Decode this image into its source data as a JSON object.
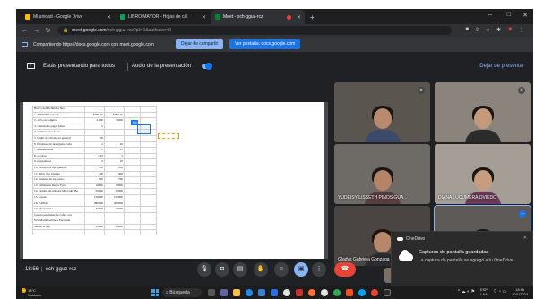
{
  "browser": {
    "tabs": [
      {
        "label": "Mi unidad - Google Drive",
        "favicon_color": "#fbbc04"
      },
      {
        "label": "LIBRO MAYOR - Hojas de cál",
        "favicon_color": "#0f9d58"
      },
      {
        "label": "Meet - och-gguz-rcz",
        "favicon_color": "#00832d"
      }
    ],
    "new_tab": "+",
    "window_controls": {
      "minimize": "–",
      "maximize": "□",
      "close": "✕"
    },
    "url_domain": "meet.google.com",
    "url_path": "/och-gguz-rcz?pli=1&authuser=0"
  },
  "share_bar": {
    "text": "Compartiendo https://docs.google.com con meet.google.com",
    "stop_label": "Dejar de compartir",
    "show_label": "Ver pestaña: docs.google.com"
  },
  "presenting": {
    "message": "Estás presentando para todos",
    "audio_label": "Audio de la presentación",
    "audio_on": true,
    "stop_label": "Dejar de presentar"
  },
  "sheet": {
    "selection_tag": "Fiil",
    "rows": [
      [
        "Banco del Pichincha Nro.",
        "",
        "",
        "",
        ""
      ],
      [
        "1. 34567390 valor S",
        "$780,25",
        "$780,25",
        "",
        ""
      ],
      [
        "2. 15% en compras",
        "5.000",
        "5000",
        "",
        ""
      ],
      [
        "3. cuentas de pagar 1mes",
        "5",
        "",
        "",
        ""
      ],
      [
        "4. archivadores de un",
        "",
        "",
        "",
        ""
      ],
      [
        "5. Útiles de oficina en general",
        "50",
        "",
        "",
        ""
      ],
      [
        "6. fundones de detergente cada",
        "2",
        "20",
        "",
        ""
      ],
      [
        "7. desinfectante",
        "2",
        "12",
        "",
        ""
      ],
      [
        "8. escobas",
        "1.25",
        "5",
        "",
        ""
      ],
      [
        "9. trapeadores",
        "2",
        "10",
        "",
        ""
      ],
      [
        "10. escritorios tipo gerente",
        "250",
        "500",
        "",
        ""
      ],
      [
        "11. sillas tipo gerente",
        "100",
        "400",
        "",
        ""
      ],
      [
        "12. estantes de tres pisos",
        "200",
        "700",
        "",
        ""
      ],
      [
        "13. camioneta marca Ford",
        "16000",
        "16000",
        "",
        ""
      ],
      [
        "14. camión de rematre Mercades Be",
        "50000",
        "50000",
        "",
        ""
      ],
      [
        "15. forraza",
        "150000",
        "150000",
        "",
        ""
      ],
      [
        "16. Edificio",
        "280000",
        "280000",
        "",
        ""
      ],
      [
        "17. Maquinaria",
        "40000",
        "40000",
        "",
        ""
      ],
      [
        "Cuenta pendiente de cobro a la",
        "",
        "",
        "",
        ""
      ],
      [
        "Sra. María Gabriela Encalada",
        "",
        "",
        "",
        ""
      ],
      [
        "menos al uno",
        "20000",
        "20000",
        "",
        ""
      ],
      [
        "",
        "",
        "",
        "",
        ""
      ]
    ]
  },
  "participants": [
    {
      "name": "",
      "muted": true,
      "bg": "#5b5550",
      "skin": "#b88a6e",
      "shirt": "#3b4a6b"
    },
    {
      "name": "",
      "muted": true,
      "bg": "#8a847d",
      "skin": "#c49a7c",
      "shirt": "#2c2c2c"
    },
    {
      "name": "YUDEISY LISSETH PINOS GUA...",
      "muted": false,
      "bg": "#6e6a66",
      "skin": "#b58468",
      "shirt": "#5a3d3d"
    },
    {
      "name": "DIANA LUCUMERA OVIEDO",
      "muted": false,
      "bg": "#a49e96",
      "skin": "#c79d80",
      "shirt": "#6b3a56"
    },
    {
      "name": "Gladys Gabriela Gonzaga Cab...",
      "muted": false,
      "bg": "#4a4542",
      "skin": "#b6876a",
      "shirt": "#2b2b30"
    },
    {
      "name": "KAREN MICHEL QUEZADA VACA",
      "muted": false,
      "bg": "#5e5a57",
      "skin": "#bf9276",
      "shirt": "#c4c0b8"
    },
    {
      "name": "",
      "muted": false,
      "bg": "#7a6f62",
      "skin": "#b98a6c",
      "shirt": "#8a3d3d"
    }
  ],
  "meeting": {
    "time": "18:56",
    "code": "och-gguz-rcz",
    "controls": [
      {
        "name": "mic-button",
        "icon": "🎙"
      },
      {
        "name": "camera-button",
        "icon": "◘"
      },
      {
        "name": "captions-button",
        "icon": "▤"
      },
      {
        "name": "raise-hand-button",
        "icon": "✋"
      },
      {
        "name": "reactions-button",
        "icon": "☺"
      },
      {
        "name": "present-button",
        "icon": "▣"
      },
      {
        "name": "more-options-button",
        "icon": "⋮"
      }
    ],
    "end_icon": "☎"
  },
  "notification": {
    "app": "OneDrive",
    "title": "Capturas de pantalla guardadas",
    "body": "La captura de pantalla se agregó a tu OneDrive."
  },
  "taskbar": {
    "temp": "18°C",
    "weather": "Nublado",
    "search_label": "Búsqueda",
    "lang_top": "ESP",
    "lang_bottom": "LAA",
    "time": "18:56",
    "date": "30/1/2024"
  }
}
